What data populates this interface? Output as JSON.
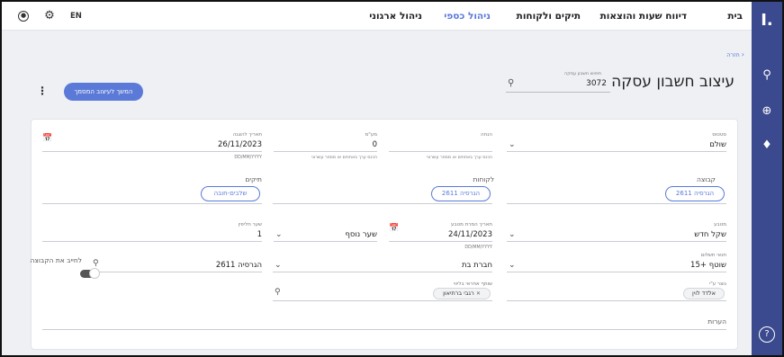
{
  "sidebar": {
    "logo": "I.",
    "icons": [
      "search-icon",
      "plus-circle-icon",
      "bell-icon"
    ],
    "help": "?"
  },
  "topbar": {
    "nav": [
      "בית",
      "דיווח שעות והוצאות",
      "תיקים ולקוחות",
      "ניהול כספי",
      "ניהול ארגוני"
    ],
    "active_nav": "ניהול כספי",
    "lang": "EN",
    "icons": [
      "user-circle-icon",
      "gear-icon"
    ]
  },
  "page": {
    "back_label": "חזרה",
    "title": "עיצוב חשבון עסקה",
    "search_label": "חיפוש חשבון עסקה",
    "search_value": "3072",
    "cta_label": "המשך לעיצוב המסמך"
  },
  "form": {
    "status": {
      "label": "סטטוס",
      "value": "שולם"
    },
    "discount": {
      "label": "הנחה",
      "value": "",
      "hint": "הכנס ערך באחוזים או מספר עשרוני"
    },
    "vat": {
      "label": "מע\"מ",
      "value": "0",
      "hint": "הכנס ערך באחוזים או מספר עשרוני"
    },
    "invoice_date": {
      "label": "תאריך להצגה",
      "value": "26/11/2023",
      "hint": "DD/MM/YYYY"
    },
    "group": {
      "label": "קבוצה",
      "chip": "הגרסיה 2611"
    },
    "clients": {
      "label": "לקוחות",
      "chip": "הגרסיה 2611"
    },
    "cases": {
      "label": "תיקים",
      "chip": "שלבים-חובה"
    },
    "currency": {
      "label": "מטבע",
      "value": "שקל חדש"
    },
    "conversion_date": {
      "label": "תאריך המרת מטבע",
      "value": "24/11/2023",
      "hint": "DD/MM/YYYY"
    },
    "extra_rate": {
      "label": "",
      "value": "שער נוסף"
    },
    "exchange_rate": {
      "label": "שער חליפין",
      "value": "1"
    },
    "payment_terms": {
      "label": "תנאי תשלום",
      "value": "שוטף +15"
    },
    "subsidiary": {
      "label": "",
      "value": "חברת בת"
    },
    "group_search": {
      "label": "",
      "value": "הגרסיה 2611"
    },
    "charge_group": {
      "label": "לחייב את הקבוצה"
    },
    "creator": {
      "label": "נוצר ע\"י",
      "chip": "אלדד לוין"
    },
    "responsible": {
      "label": "שותף אחראי בליווי",
      "chip": "רגבי ברתיאון"
    },
    "notes": {
      "label": "הערות"
    }
  }
}
